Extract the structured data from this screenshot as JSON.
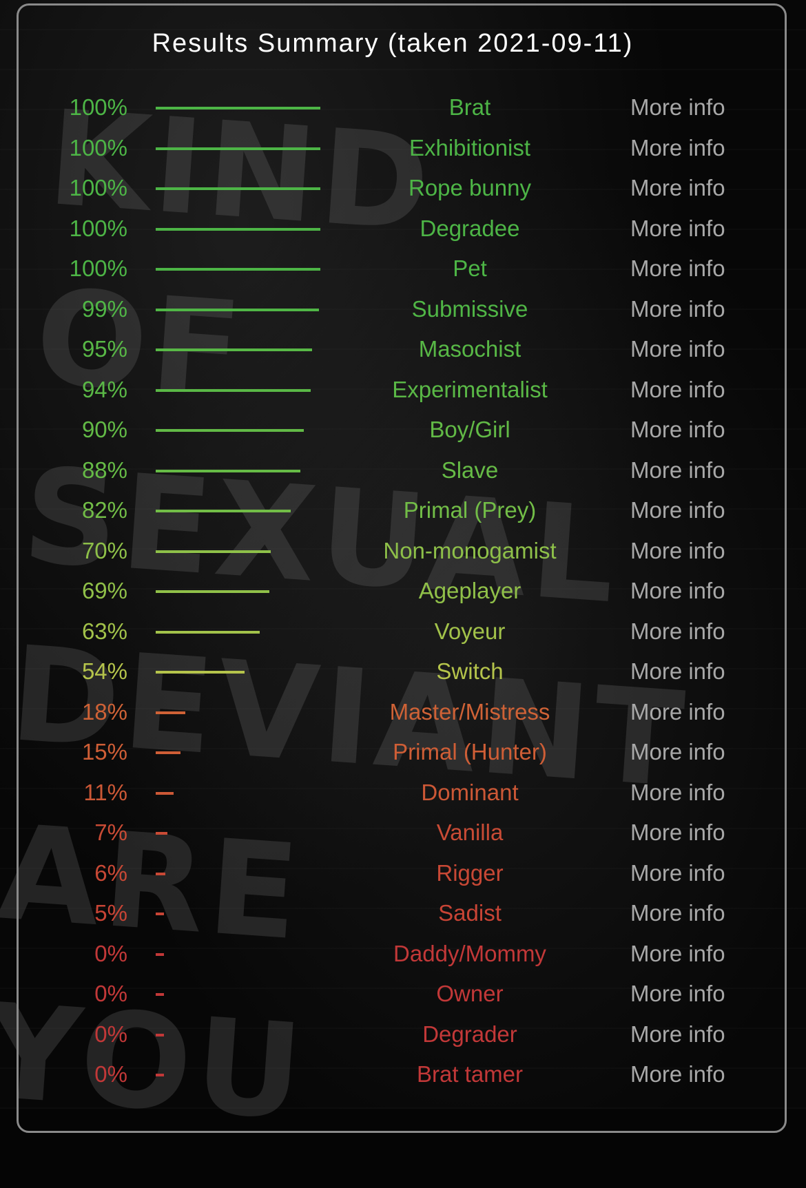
{
  "header": {
    "title": "Results Summary (taken 2021-09-11)"
  },
  "background": {
    "graffiti_text": "KIND OF SEXUAL DEVIANT ARE YOU"
  },
  "more_info_label": "More info",
  "chart_data": {
    "type": "bar",
    "orientation": "horizontal",
    "title": "Results Summary (taken 2021-09-11)",
    "xlim": [
      0,
      100
    ],
    "unit": "%",
    "categories": [
      "Brat",
      "Exhibitionist",
      "Rope bunny",
      "Degradee",
      "Pet",
      "Submissive",
      "Masochist",
      "Experimentalist",
      "Boy/Girl",
      "Slave",
      "Primal (Prey)",
      "Non-monogamist",
      "Ageplayer",
      "Voyeur",
      "Switch",
      "Master/Mistress",
      "Primal (Hunter)",
      "Dominant",
      "Vanilla",
      "Rigger",
      "Sadist",
      "Daddy/Mommy",
      "Owner",
      "Degrader",
      "Brat tamer"
    ],
    "values": [
      100,
      100,
      100,
      100,
      100,
      99,
      95,
      94,
      90,
      88,
      82,
      70,
      69,
      63,
      54,
      18,
      15,
      11,
      7,
      6,
      5,
      0,
      0,
      0,
      0
    ],
    "labels": [
      "100%",
      "100%",
      "100%",
      "100%",
      "100%",
      "99%",
      "95%",
      "94%",
      "90%",
      "88%",
      "82%",
      "70%",
      "69%",
      "63%",
      "54%",
      "18%",
      "15%",
      "11%",
      "7%",
      "6%",
      "5%",
      "0%",
      "0%",
      "0%",
      "0%"
    ],
    "colors": [
      "#4db546",
      "#4db546",
      "#4db546",
      "#4db546",
      "#4db546",
      "#50b646",
      "#58b846",
      "#5ab846",
      "#62ba46",
      "#66bb46",
      "#72bd47",
      "#8ec049",
      "#90c049",
      "#a2c24a",
      "#b5c44b",
      "#cf6236",
      "#cf5e36",
      "#cc5836",
      "#c94b35",
      "#c84835",
      "#c84435",
      "#c23838",
      "#c23838",
      "#c23838",
      "#c23838"
    ]
  }
}
